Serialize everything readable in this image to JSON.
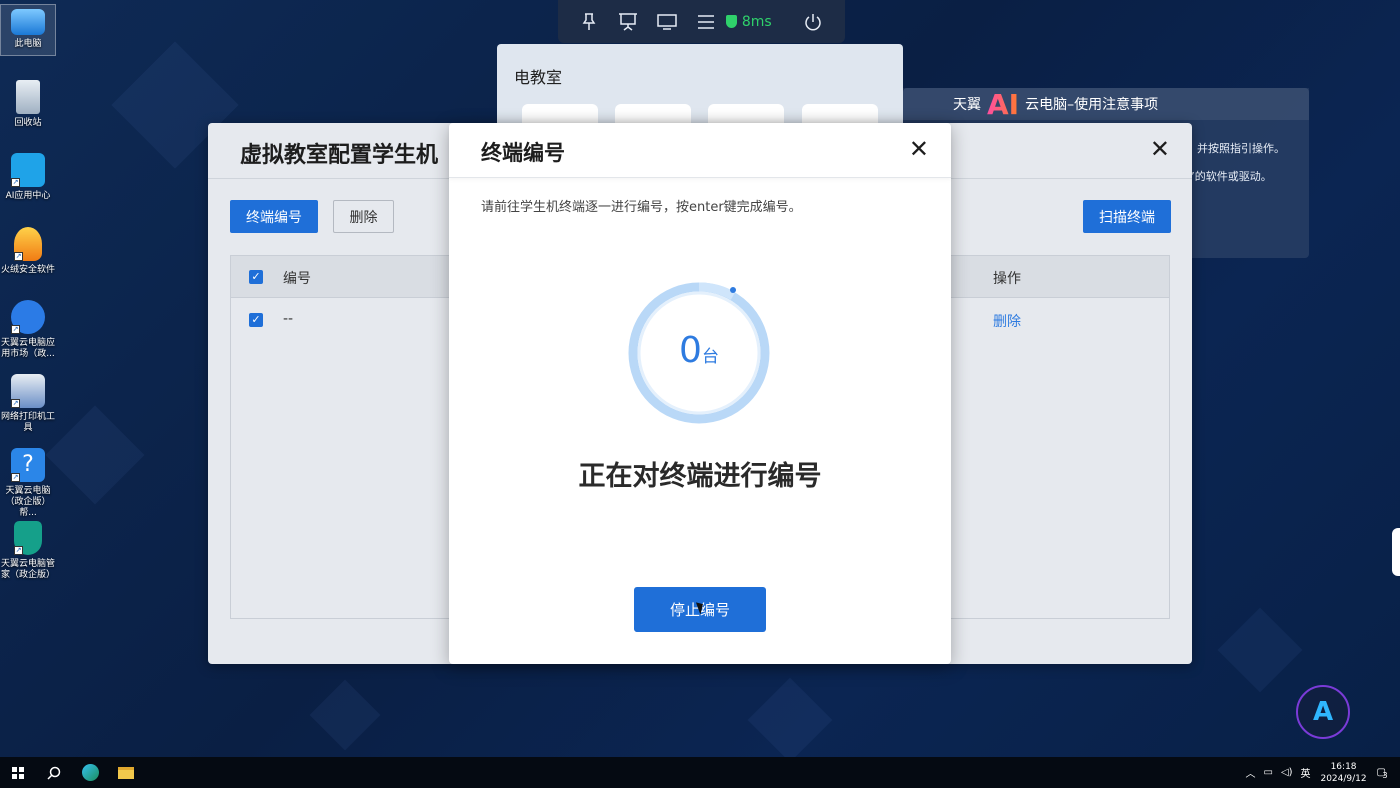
{
  "desktop": {
    "icons": [
      {
        "label": "此电脑"
      },
      {
        "label": "回收站"
      },
      {
        "label": "AI应用中心"
      },
      {
        "label": "火绒安全软件"
      },
      {
        "label": "天翼云电脑应用市场（政..."
      },
      {
        "label": "网络打印机工具"
      },
      {
        "label": "天翼云电脑（政企版）帮..."
      },
      {
        "label": "天翼云电脑管家（政企版）"
      }
    ]
  },
  "topbar": {
    "latency": "8ms",
    "icons": [
      "pin-icon",
      "presentation-icon",
      "monitor-icon",
      "menu-icon",
      "shield-icon",
      "power-icon"
    ]
  },
  "eclass_panel": {
    "title": "电教室"
  },
  "ai_notice": {
    "title_prefix": "天翼",
    "title_ai": "AI",
    "title_suffix": "云电脑–使用注意事项",
    "line1": "并按照指引操作。",
    "line2": "”的软件或驱动。"
  },
  "config_window": {
    "title": "虚拟教室配置学生机",
    "buttons": {
      "number": "终端编号",
      "delete": "删除",
      "scan": "扫描终端"
    },
    "table": {
      "headers": {
        "id": "编号",
        "action": "操作"
      },
      "rows": [
        {
          "id": "--",
          "action": "删除",
          "checked": true
        }
      ]
    }
  },
  "modal": {
    "title": "终端编号",
    "hint": "请前往学生机终端逐一进行编号，按enter键完成编号。",
    "count": "0",
    "count_unit": "台",
    "status": "正在对终端进行编号",
    "stop_button": "停止编号"
  },
  "taskbar": {
    "time": "16:18",
    "date": "2024/9/12",
    "ime": "英",
    "notification_count": "3"
  },
  "colors": {
    "primary": "#1f6fd8",
    "link": "#2e7be0",
    "latency_green": "#2fd16b"
  }
}
